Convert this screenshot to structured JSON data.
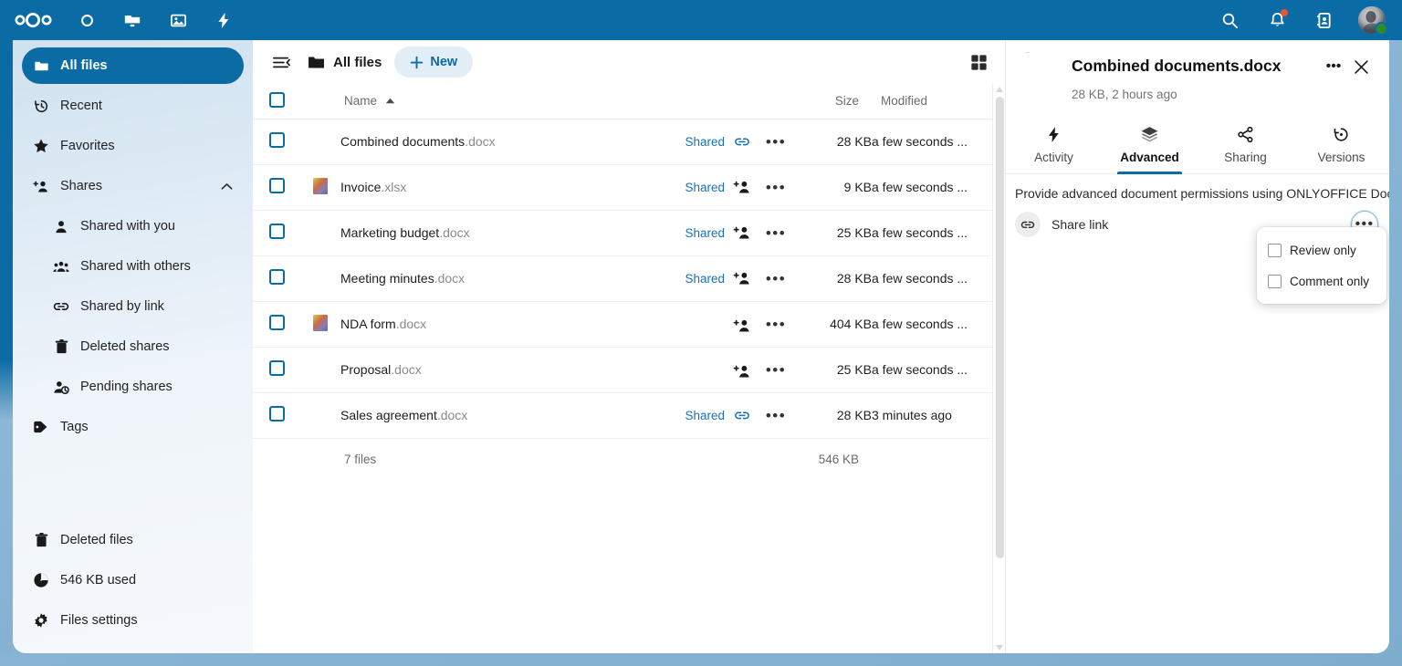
{
  "header": {
    "logo_name": "nextcloud-logo",
    "apps": [
      {
        "name": "dashboard-icon",
        "label": "Dashboard"
      },
      {
        "name": "files-icon",
        "label": "Files"
      },
      {
        "name": "photos-icon",
        "label": "Photos"
      },
      {
        "name": "activity-icon",
        "label": "Activity"
      }
    ],
    "right": [
      {
        "name": "search-icon",
        "label": "Search"
      },
      {
        "name": "notifications-icon",
        "label": "Notifications",
        "badge": true
      },
      {
        "name": "contacts-icon",
        "label": "Contacts"
      }
    ],
    "avatar_status": "online",
    "accent_color": "#0b6ba4"
  },
  "sidebar": {
    "items": [
      {
        "label": "All files",
        "icon": "folder-icon",
        "active": true,
        "sub": false
      },
      {
        "label": "Recent",
        "icon": "clock-icon",
        "active": false,
        "sub": false
      },
      {
        "label": "Favorites",
        "icon": "star-icon",
        "active": false,
        "sub": false
      },
      {
        "label": "Shares",
        "icon": "share-add-icon",
        "active": false,
        "sub": false,
        "expanded": true
      },
      {
        "label": "Shared with you",
        "icon": "person-icon",
        "active": false,
        "sub": true
      },
      {
        "label": "Shared with others",
        "icon": "people-icon",
        "active": false,
        "sub": true
      },
      {
        "label": "Shared by link",
        "icon": "link-icon",
        "active": false,
        "sub": true
      },
      {
        "label": "Deleted shares",
        "icon": "trash-icon",
        "active": false,
        "sub": true
      },
      {
        "label": "Pending shares",
        "icon": "person-clock-icon",
        "active": false,
        "sub": true
      },
      {
        "label": "Tags",
        "icon": "tag-icon",
        "active": false,
        "sub": false
      }
    ],
    "bottom_items": [
      {
        "label": "Deleted files",
        "icon": "trash-icon"
      },
      {
        "label": "546 KB used",
        "icon": "pie-chart-icon"
      },
      {
        "label": "Files settings",
        "icon": "gear-icon"
      }
    ]
  },
  "toolbar": {
    "collapse_icon": "collapse-list-icon",
    "breadcrumb": "All files",
    "breadcrumb_icon": "folder-icon",
    "new_label": "New",
    "new_icon": "plus-icon",
    "grid_toggle_icon": "grid-view-icon"
  },
  "files_table": {
    "columns": {
      "name": "Name",
      "size": "Size",
      "modified": "Modified"
    },
    "sort": {
      "column": "Name",
      "direction": "asc"
    },
    "rows": [
      {
        "name": "Combined documents",
        "ext": ".docx",
        "shared_label": "Shared",
        "share_icon": "link-icon",
        "size": "28 KB",
        "modified": "a few seconds ...",
        "thumb": false
      },
      {
        "name": "Invoice",
        "ext": ".xlsx",
        "shared_label": "Shared",
        "share_icon": "share-add-icon",
        "size": "9 KB",
        "modified": "a few seconds ...",
        "thumb": true
      },
      {
        "name": "Marketing budget",
        "ext": ".docx",
        "shared_label": "Shared",
        "share_icon": "share-add-icon",
        "size": "25 KB",
        "modified": "a few seconds ...",
        "thumb": false
      },
      {
        "name": "Meeting minutes",
        "ext": ".docx",
        "shared_label": "Shared",
        "share_icon": "share-add-icon",
        "size": "28 KB",
        "modified": "a few seconds ...",
        "thumb": false
      },
      {
        "name": "NDA form",
        "ext": ".docx",
        "shared_label": "",
        "share_icon": "share-add-icon",
        "size": "404 KB",
        "modified": "a few seconds ...",
        "thumb": true
      },
      {
        "name": "Proposal",
        "ext": ".docx",
        "shared_label": "",
        "share_icon": "share-add-icon",
        "size": "25 KB",
        "modified": "a few seconds ...",
        "thumb": false
      },
      {
        "name": "Sales agreement",
        "ext": ".docx",
        "shared_label": "Shared",
        "share_icon": "link-icon",
        "size": "28 KB",
        "modified": "3 minutes ago",
        "thumb": false
      }
    ],
    "summary": {
      "count": "7 files",
      "total_size": "546 KB"
    },
    "menu_glyph": "•••"
  },
  "details": {
    "title": "Combined documents.docx",
    "subtitle": "28 KB, 2 hours ago",
    "menu_glyph": "•••",
    "close_glyph": "✕",
    "tabs": [
      {
        "label": "Activity",
        "icon": "activity-icon",
        "active": false
      },
      {
        "label": "Advanced",
        "icon": "layers-icon",
        "active": true
      },
      {
        "label": "Sharing",
        "icon": "share-icon",
        "active": false
      },
      {
        "label": "Versions",
        "icon": "history-icon",
        "active": false
      }
    ],
    "advanced": {
      "description": "Provide advanced document permissions using ONLYOFFICE Docs",
      "share_link_label": "Share link",
      "share_link_icon": "link-icon",
      "menu_glyph": "•••",
      "permissions": [
        {
          "label": "Review only",
          "checked": false
        },
        {
          "label": "Comment only",
          "checked": false
        }
      ]
    }
  }
}
